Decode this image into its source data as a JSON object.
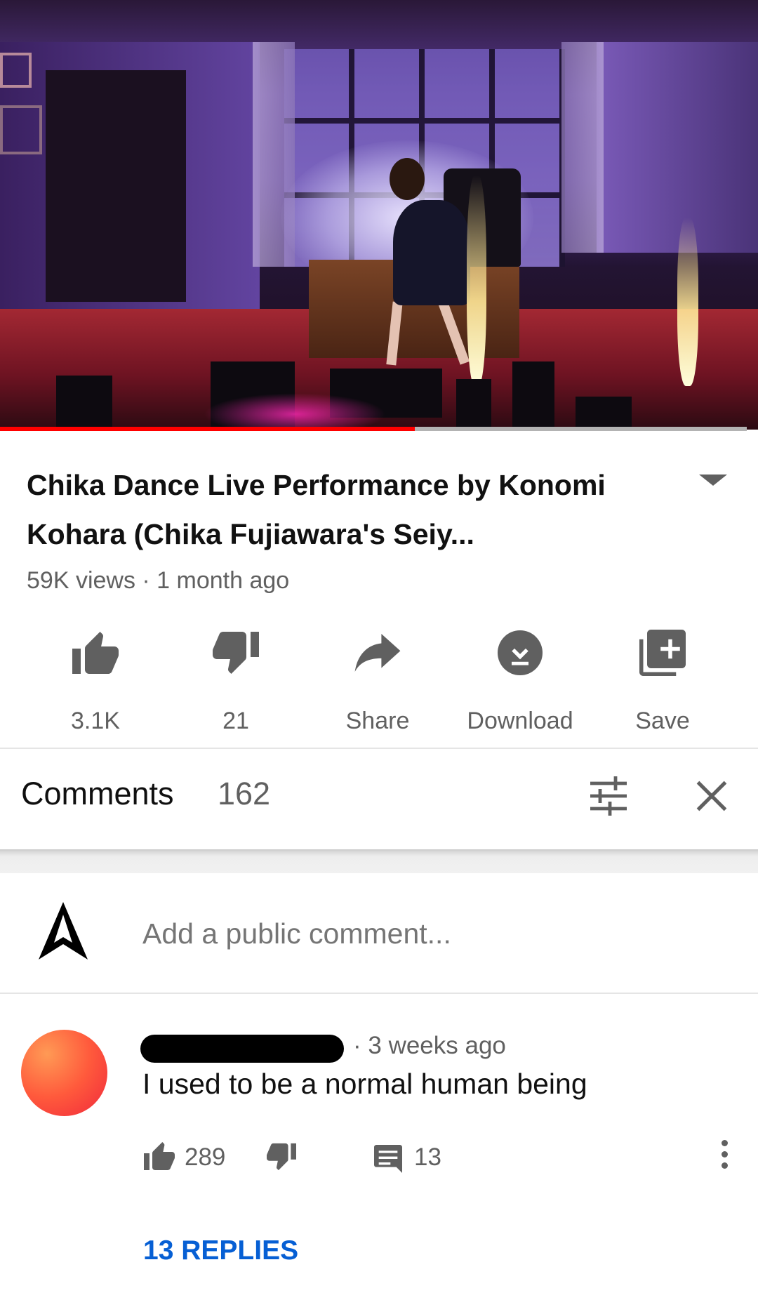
{
  "player": {
    "progress_fraction": 0.555,
    "progress_color": "#ff0000"
  },
  "video": {
    "title": "Chika Dance Live Performance by Konomi Kohara (Chika Fujiawara's Seiy...",
    "meta": "59K views · 1 month ago"
  },
  "actions": [
    {
      "icon": "thumb-up-icon",
      "label": "3.1K"
    },
    {
      "icon": "thumb-down-icon",
      "label": "21"
    },
    {
      "icon": "share-icon",
      "label": "Share"
    },
    {
      "icon": "download-icon",
      "label": "Download"
    },
    {
      "icon": "add-to-playlist-icon",
      "label": "Save"
    }
  ],
  "comments": {
    "title": "Comments",
    "count": "162",
    "add_placeholder": "Add a public comment...",
    "items": [
      {
        "author": "",
        "time": "· 3 weeks ago",
        "text": "I used to be a normal human being",
        "likes": "289",
        "reply_count": "13",
        "replies_link": "13 REPLIES"
      }
    ]
  },
  "colors": {
    "link": "#065fd4",
    "secondary_text": "#606060"
  }
}
